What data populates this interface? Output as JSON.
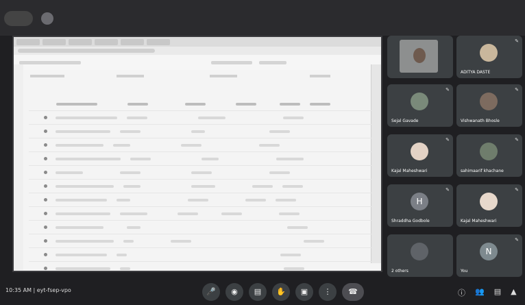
{
  "topbar": {
    "chip_label": "",
    "presenting_text": "",
    "accent": "#3c4043"
  },
  "participants": [
    {
      "name": "",
      "type": "video"
    },
    {
      "name": "ADITYA DASTE",
      "type": "avatar",
      "color": "#c9b79c"
    },
    {
      "name": "Sejal Gavade",
      "type": "avatar",
      "color": "#7a8a7a"
    },
    {
      "name": "Vishwanath Bhosle",
      "type": "avatar",
      "color": "#7d6b5f"
    },
    {
      "name": "Kajal Maheshwari",
      "type": "avatar",
      "color": "#e3d2c5"
    },
    {
      "name": "sahimaarif khachane",
      "type": "avatar",
      "color": "#6f7d6c"
    },
    {
      "name": "Shraddha Godbole",
      "type": "letter",
      "letter": "H",
      "color": "#7b7f86"
    },
    {
      "name": "Kajal Maheshwari",
      "type": "avatar",
      "color": "#e7d8cb"
    },
    {
      "name": "2 others",
      "type": "group",
      "color": "#5f6368"
    },
    {
      "name": "You",
      "type": "letter",
      "letter": "N",
      "color": "#7e8a8f"
    }
  ],
  "bottom": {
    "clock": "10:35 AM | eyt-fsep-vpo"
  }
}
